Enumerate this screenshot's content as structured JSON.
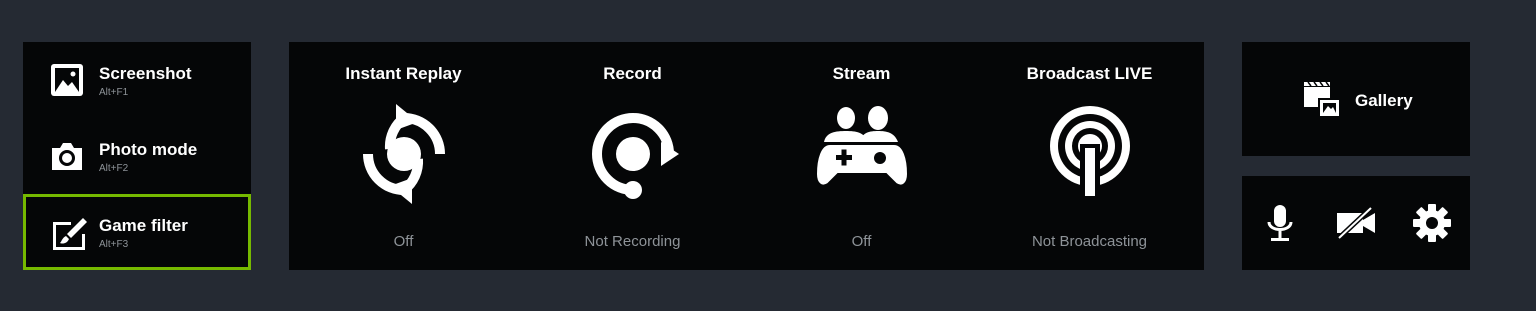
{
  "capture_list": [
    {
      "label": "Screenshot",
      "hotkey": "Alt+F1",
      "icon": "image-icon",
      "active": false
    },
    {
      "label": "Photo mode",
      "hotkey": "Alt+F2",
      "icon": "camera-icon",
      "active": false
    },
    {
      "label": "Game filter",
      "hotkey": "Alt+F3",
      "icon": "filter-edit-icon",
      "active": true
    }
  ],
  "features": [
    {
      "title": "Instant Replay",
      "status": "Off",
      "icon": "instant-replay-icon"
    },
    {
      "title": "Record",
      "status": "Not Recording",
      "icon": "record-icon"
    },
    {
      "title": "Stream",
      "status": "Off",
      "icon": "stream-gamepad-icon"
    },
    {
      "title": "Broadcast LIVE",
      "status": "Not Broadcasting",
      "icon": "broadcast-icon"
    }
  ],
  "gallery": {
    "label": "Gallery",
    "icon": "gallery-clapper-icon"
  },
  "tools": [
    {
      "name": "microphone",
      "icon": "microphone-icon"
    },
    {
      "name": "camera-off",
      "icon": "camera-off-icon"
    },
    {
      "name": "settings",
      "icon": "gear-icon"
    }
  ],
  "colors": {
    "accent": "#76b900",
    "background": "#252a33",
    "panel": "#050607",
    "status_text": "#8e9398"
  }
}
